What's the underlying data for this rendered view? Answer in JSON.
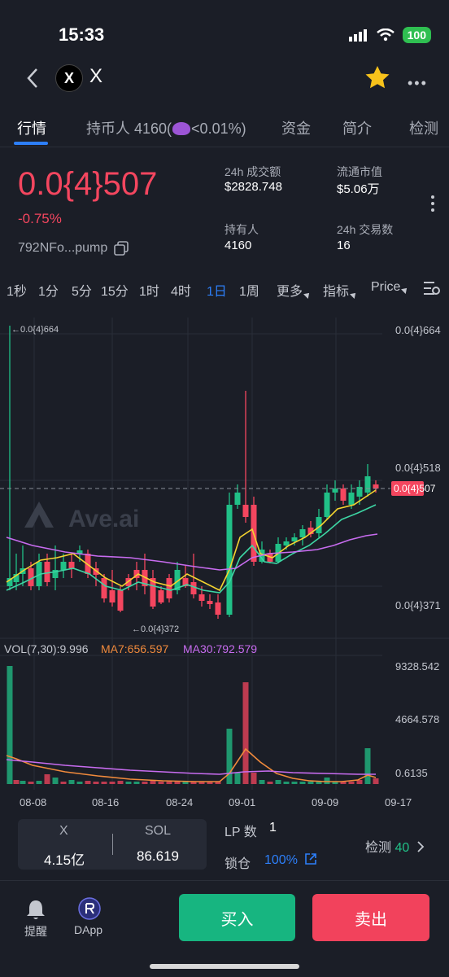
{
  "status_bar": {
    "time": "15:33",
    "battery": "100"
  },
  "header": {
    "logo_letter": "X",
    "title": "X"
  },
  "tabs": [
    {
      "label": "行情"
    },
    {
      "label_prefix": "持币人 4160(",
      "label_suffix": "<0.01%)"
    },
    {
      "label": "资金"
    },
    {
      "label": "简介"
    },
    {
      "label": "检测"
    }
  ],
  "price": {
    "value": "0.0{4}507",
    "change": "-0.75%",
    "address": "792NFo...pump"
  },
  "stats": {
    "volume_24h": {
      "label": "24h 成交额",
      "value": "$2828.748"
    },
    "market_cap": {
      "label": "流通市值",
      "value": "$5.06万"
    },
    "holders": {
      "label": "持有人",
      "value": "4160"
    },
    "tx_24h": {
      "label": "24h 交易数",
      "value": "16"
    }
  },
  "timeframes": [
    "1秒",
    "1分",
    "5分",
    "15分",
    "1时",
    "4时",
    "1日",
    "1周"
  ],
  "timeframe_active": "1日",
  "toolbar": {
    "more": "更多",
    "indicators": "指标",
    "price": "Price"
  },
  "chart_data": {
    "type": "candlestick",
    "watermark": "Ave.ai",
    "price_axis_labels": [
      "0.0{4}664",
      "0.0{4}518",
      "0.0{4}371"
    ],
    "current_price_tag": "0.0{4}507",
    "max_marker": "←0.0{4}664",
    "min_marker": "←0.0{4}372",
    "x_tick_labels": [
      "08-08",
      "08-16",
      "08-24",
      "09-01",
      "09-09",
      "09-17"
    ],
    "volume_legend": {
      "vol": "VOL(7,30):9.996",
      "ma7": "MA7:656.597",
      "ma30": "MA30:792.579"
    },
    "volume_axis_labels": [
      "9328.542",
      "4664.578",
      "0.6135"
    ],
    "colors": {
      "up": "#21c087",
      "down": "#f4465f",
      "ma_yellow": "#f5d430",
      "ma_green": "#3dd6a4",
      "ma_purple": "#c86cf0",
      "vol_ma7": "#f08a3c",
      "vol_ma30": "#c86cf0"
    }
  },
  "token_box": {
    "token_label": "X",
    "token_value": "4.15亿",
    "sol_label": "SOL",
    "sol_value": "86.619"
  },
  "lp": {
    "label": "LP 数",
    "value": "1"
  },
  "lock": {
    "label": "锁仓",
    "value": "100%"
  },
  "detect": {
    "label": "检测",
    "value": "40"
  },
  "bottom_nav": {
    "alert": "提醒",
    "dapp": "DApp",
    "buy": "买入",
    "sell": "卖出"
  }
}
